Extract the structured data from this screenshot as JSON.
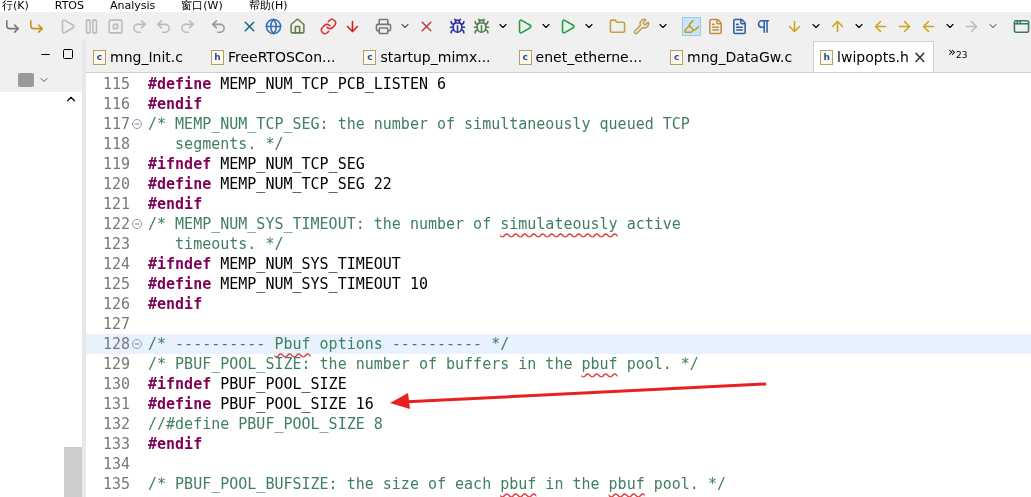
{
  "menu": [
    "行(K)",
    "RTOS",
    "Analysis",
    "窗口(W)",
    "帮助(H)"
  ],
  "tabs": [
    {
      "icon_letter": "c",
      "label": "mng_Init.c",
      "selected": false
    },
    {
      "icon_letter": "h",
      "label": "FreeRTOSCon...",
      "selected": false
    },
    {
      "icon_letter": "c",
      "label": "startup_mimx...",
      "selected": false
    },
    {
      "icon_letter": "c",
      "label": "enet_etherne...",
      "selected": false
    },
    {
      "icon_letter": "c",
      "label": "mng_DataGw.c",
      "selected": false
    },
    {
      "icon_letter": "h",
      "label": "lwipopts.h",
      "selected": true,
      "close": "×"
    }
  ],
  "tab_overflow": {
    "chevron": "»",
    "count": "23"
  },
  "code": {
    "lines": [
      {
        "number": "115",
        "fold": false,
        "segments": [
          {
            "kind": "keyword",
            "text": "#define"
          },
          {
            "kind": "plain",
            "text": " MEMP_NUM_TCP_PCB_LISTEN 6"
          }
        ]
      },
      {
        "number": "116",
        "fold": false,
        "segments": [
          {
            "kind": "keyword",
            "text": "#endif"
          }
        ]
      },
      {
        "number": "117",
        "fold": true,
        "segments": [
          {
            "kind": "comment",
            "text": "/* MEMP_NUM_TCP_SEG: the number of simultaneously queued TCP"
          }
        ]
      },
      {
        "number": "118",
        "fold": false,
        "segments": [
          {
            "kind": "comment",
            "text": "   segments. */"
          }
        ]
      },
      {
        "number": "119",
        "fold": false,
        "segments": [
          {
            "kind": "keyword",
            "text": "#ifndef"
          },
          {
            "kind": "plain",
            "text": " MEMP_NUM_TCP_SEG"
          }
        ]
      },
      {
        "number": "120",
        "fold": false,
        "segments": [
          {
            "kind": "keyword",
            "text": "#define"
          },
          {
            "kind": "plain",
            "text": " MEMP_NUM_TCP_SEG 22"
          }
        ]
      },
      {
        "number": "121",
        "fold": false,
        "segments": [
          {
            "kind": "keyword",
            "text": "#endif"
          }
        ]
      },
      {
        "number": "122",
        "fold": true,
        "segments": [
          {
            "kind": "comment",
            "text": "/* MEMP_NUM_SYS_TIMEOUT: the number of "
          },
          {
            "kind": "misspelled",
            "text": "simulateously"
          },
          {
            "kind": "comment",
            "text": " active"
          }
        ]
      },
      {
        "number": "123",
        "fold": false,
        "segments": [
          {
            "kind": "comment",
            "text": "   timeouts. */"
          }
        ]
      },
      {
        "number": "124",
        "fold": false,
        "segments": [
          {
            "kind": "keyword",
            "text": "#ifndef"
          },
          {
            "kind": "plain",
            "text": " MEMP_NUM_SYS_TIMEOUT"
          }
        ]
      },
      {
        "number": "125",
        "fold": false,
        "segments": [
          {
            "kind": "keyword",
            "text": "#define"
          },
          {
            "kind": "plain",
            "text": " MEMP_NUM_SYS_TIMEOUT 10"
          }
        ]
      },
      {
        "number": "126",
        "fold": false,
        "segments": [
          {
            "kind": "keyword",
            "text": "#endif"
          }
        ]
      },
      {
        "number": "127",
        "fold": false
      },
      {
        "number": "128",
        "fold": true,
        "current": true,
        "segments": [
          {
            "kind": "comment",
            "text": "/* ---------- "
          },
          {
            "kind": "misspelled",
            "text": "Pbuf"
          },
          {
            "kind": "comment",
            "text": " options ---------- */"
          }
        ]
      },
      {
        "number": "129",
        "fold": false,
        "segments": [
          {
            "kind": "comment",
            "text": "/* PBUF_POOL_SIZE: the number of buffers in the "
          },
          {
            "kind": "misspelled",
            "text": "pbuf"
          },
          {
            "kind": "comment",
            "text": " pool. */"
          }
        ]
      },
      {
        "number": "130",
        "fold": false,
        "segments": [
          {
            "kind": "keyword",
            "text": "#ifndef"
          },
          {
            "kind": "plain",
            "text": " PBUF_POOL_SIZE"
          }
        ]
      },
      {
        "number": "131",
        "fold": false,
        "segments": [
          {
            "kind": "keyword",
            "text": "#define"
          },
          {
            "kind": "plain",
            "text": " PBUF_POOL_SIZE 16"
          }
        ]
      },
      {
        "number": "132",
        "fold": false,
        "segments": [
          {
            "kind": "comment",
            "text": "//#define PBUF_POOL_SIZE 8"
          }
        ]
      },
      {
        "number": "133",
        "fold": false,
        "segments": [
          {
            "kind": "keyword",
            "text": "#endif"
          }
        ]
      },
      {
        "number": "134",
        "fold": false
      },
      {
        "number": "135",
        "fold": false,
        "segments": [
          {
            "kind": "comment",
            "text": "/* PBUF_POOL_BUFSIZE: the size of each "
          },
          {
            "kind": "misspelled",
            "text": "pbuf"
          },
          {
            "kind": "comment",
            "text": " in the "
          },
          {
            "kind": "misspelled",
            "text": "pbuf"
          },
          {
            "kind": "comment",
            "text": " pool. */"
          }
        ]
      }
    ]
  }
}
